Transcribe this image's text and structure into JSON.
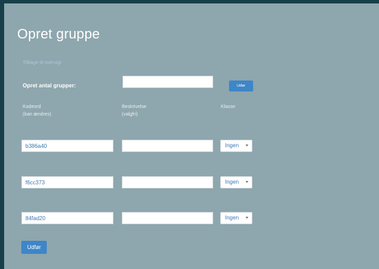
{
  "page": {
    "title": "Opret gruppe",
    "back_link": "Tilbage til oversigt"
  },
  "create": {
    "label": "Opret antal grupper:",
    "count_value": "",
    "button_label": "Udfør"
  },
  "columns": {
    "password_line1": "Kodeord",
    "password_line2": "(kan ændres)",
    "description_line1": "Beskrivelse",
    "description_line2": "(valgfri)",
    "class": "Klasse"
  },
  "groups": [
    {
      "password": "b386a40",
      "description": "",
      "class": "Ingen"
    },
    {
      "password": "f6cc373",
      "description": "",
      "class": "Ingen"
    },
    {
      "password": "84fad20",
      "description": "",
      "class": "Ingen"
    }
  ],
  "submit": {
    "label": "Udfør"
  },
  "colors": {
    "background": "#8ea6ad",
    "frame": "#173f4a",
    "accent": "#3d86c8",
    "link": "#a9c8e0",
    "input_text": "#3f78b4"
  }
}
